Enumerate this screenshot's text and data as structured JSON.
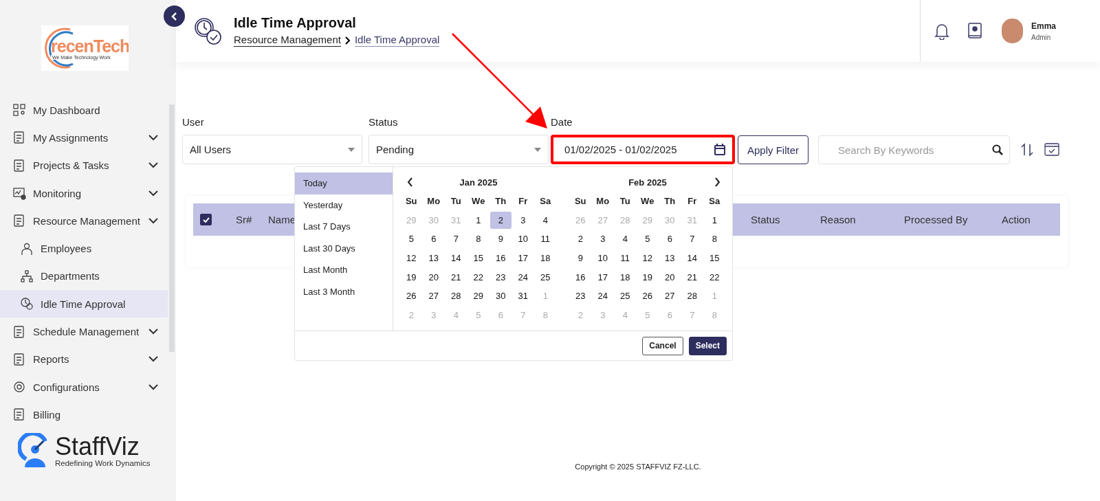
{
  "sidebar": {
    "logo": {
      "name": "recenTech",
      "tagline": "We Make Technology Work"
    },
    "items": [
      {
        "label": "My Dashboard",
        "submenu": false,
        "selected": false
      },
      {
        "label": "My Assignments",
        "submenu": true,
        "selected": false
      },
      {
        "label": "Projects & Tasks",
        "submenu": true,
        "selected": false
      },
      {
        "label": "Monitoring",
        "submenu": true,
        "selected": false
      },
      {
        "label": "Resource Management",
        "submenu": true,
        "selected": false,
        "children": [
          {
            "label": "Employees",
            "selected": false
          },
          {
            "label": "Departments",
            "selected": false
          },
          {
            "label": "Idle Time Approval",
            "selected": true
          }
        ]
      },
      {
        "label": "Schedule Management",
        "submenu": true,
        "selected": false
      },
      {
        "label": "Reports",
        "submenu": true,
        "selected": false
      },
      {
        "label": "Configurations",
        "submenu": true,
        "selected": false
      },
      {
        "label": "Billing",
        "submenu": false,
        "selected": false
      }
    ],
    "brand": {
      "name": "StaffViz",
      "tagline": "Redefining Work Dynamics"
    }
  },
  "header": {
    "title": "Idle Time Approval",
    "breadcrumb": [
      {
        "label": "Resource Management",
        "current": false
      },
      {
        "label": "Idle Time Approval",
        "current": true
      }
    ],
    "user": {
      "name": "Emma",
      "role": "Admin"
    }
  },
  "filters": {
    "user": {
      "label": "User",
      "value": "All Users"
    },
    "status": {
      "label": "Status",
      "value": "Pending"
    },
    "date": {
      "label": "Date",
      "value": "01/02/2025 - 01/02/2025",
      "highlighted": true
    },
    "apply": "Apply Filter",
    "search": {
      "placeholder": "Search By Keywords"
    }
  },
  "table": {
    "select_all_checked": true,
    "columns": [
      "Sr#",
      "Name",
      "Status",
      "Reason",
      "Processed By",
      "Action"
    ]
  },
  "date_picker": {
    "ranges": [
      {
        "label": "Today",
        "selected": true
      },
      {
        "label": "Yesterday",
        "selected": false
      },
      {
        "label": "Last 7 Days",
        "selected": false
      },
      {
        "label": "Last 30 Days",
        "selected": false
      },
      {
        "label": "Last Month",
        "selected": false
      },
      {
        "label": "Last 3 Month",
        "selected": false
      }
    ],
    "months": [
      {
        "title": "Jan 2025",
        "weekdays": [
          "Su",
          "Mo",
          "Tu",
          "We",
          "Th",
          "Fr",
          "Sa"
        ],
        "days": [
          {
            "day": "29",
            "muted": true,
            "selected": false
          },
          {
            "day": "30",
            "muted": true,
            "selected": false
          },
          {
            "day": "31",
            "muted": true,
            "selected": false
          },
          {
            "day": "1",
            "muted": false,
            "selected": false
          },
          {
            "day": "2",
            "muted": false,
            "selected": true
          },
          {
            "day": "3",
            "muted": false,
            "selected": false
          },
          {
            "day": "4",
            "muted": false,
            "selected": false
          },
          {
            "day": "5",
            "muted": false,
            "selected": false
          },
          {
            "day": "6",
            "muted": false,
            "selected": false
          },
          {
            "day": "7",
            "muted": false,
            "selected": false
          },
          {
            "day": "8",
            "muted": false,
            "selected": false
          },
          {
            "day": "9",
            "muted": false,
            "selected": false
          },
          {
            "day": "10",
            "muted": false,
            "selected": false
          },
          {
            "day": "11",
            "muted": false,
            "selected": false
          },
          {
            "day": "12",
            "muted": false,
            "selected": false
          },
          {
            "day": "13",
            "muted": false,
            "selected": false
          },
          {
            "day": "14",
            "muted": false,
            "selected": false
          },
          {
            "day": "15",
            "muted": false,
            "selected": false
          },
          {
            "day": "16",
            "muted": false,
            "selected": false
          },
          {
            "day": "17",
            "muted": false,
            "selected": false
          },
          {
            "day": "18",
            "muted": false,
            "selected": false
          },
          {
            "day": "19",
            "muted": false,
            "selected": false
          },
          {
            "day": "20",
            "muted": false,
            "selected": false
          },
          {
            "day": "21",
            "muted": false,
            "selected": false
          },
          {
            "day": "22",
            "muted": false,
            "selected": false
          },
          {
            "day": "23",
            "muted": false,
            "selected": false
          },
          {
            "day": "24",
            "muted": false,
            "selected": false
          },
          {
            "day": "25",
            "muted": false,
            "selected": false
          },
          {
            "day": "26",
            "muted": false,
            "selected": false
          },
          {
            "day": "27",
            "muted": false,
            "selected": false
          },
          {
            "day": "28",
            "muted": false,
            "selected": false
          },
          {
            "day": "29",
            "muted": false,
            "selected": false
          },
          {
            "day": "30",
            "muted": false,
            "selected": false
          },
          {
            "day": "31",
            "muted": false,
            "selected": false
          },
          {
            "day": "1",
            "muted": true,
            "selected": false
          },
          {
            "day": "2",
            "muted": true,
            "selected": false
          },
          {
            "day": "3",
            "muted": true,
            "selected": false
          },
          {
            "day": "4",
            "muted": true,
            "selected": false
          },
          {
            "day": "5",
            "muted": true,
            "selected": false
          },
          {
            "day": "6",
            "muted": true,
            "selected": false
          },
          {
            "day": "7",
            "muted": true,
            "selected": false
          },
          {
            "day": "8",
            "muted": true,
            "selected": false
          }
        ]
      },
      {
        "title": "Feb 2025",
        "weekdays": [
          "Su",
          "Mo",
          "Tu",
          "We",
          "Th",
          "Fr",
          "Sa"
        ],
        "days": [
          {
            "day": "26",
            "muted": true,
            "selected": false
          },
          {
            "day": "27",
            "muted": true,
            "selected": false
          },
          {
            "day": "28",
            "muted": true,
            "selected": false
          },
          {
            "day": "29",
            "muted": true,
            "selected": false
          },
          {
            "day": "30",
            "muted": true,
            "selected": false
          },
          {
            "day": "31",
            "muted": true,
            "selected": false
          },
          {
            "day": "1",
            "muted": false,
            "selected": false
          },
          {
            "day": "2",
            "muted": false,
            "selected": false
          },
          {
            "day": "3",
            "muted": false,
            "selected": false
          },
          {
            "day": "4",
            "muted": false,
            "selected": false
          },
          {
            "day": "5",
            "muted": false,
            "selected": false
          },
          {
            "day": "6",
            "muted": false,
            "selected": false
          },
          {
            "day": "7",
            "muted": false,
            "selected": false
          },
          {
            "day": "8",
            "muted": false,
            "selected": false
          },
          {
            "day": "9",
            "muted": false,
            "selected": false
          },
          {
            "day": "10",
            "muted": false,
            "selected": false
          },
          {
            "day": "11",
            "muted": false,
            "selected": false
          },
          {
            "day": "12",
            "muted": false,
            "selected": false
          },
          {
            "day": "13",
            "muted": false,
            "selected": false
          },
          {
            "day": "14",
            "muted": false,
            "selected": false
          },
          {
            "day": "15",
            "muted": false,
            "selected": false
          },
          {
            "day": "16",
            "muted": false,
            "selected": false
          },
          {
            "day": "17",
            "muted": false,
            "selected": false
          },
          {
            "day": "18",
            "muted": false,
            "selected": false
          },
          {
            "day": "19",
            "muted": false,
            "selected": false
          },
          {
            "day": "20",
            "muted": false,
            "selected": false
          },
          {
            "day": "21",
            "muted": false,
            "selected": false
          },
          {
            "day": "22",
            "muted": false,
            "selected": false
          },
          {
            "day": "23",
            "muted": false,
            "selected": false
          },
          {
            "day": "24",
            "muted": false,
            "selected": false
          },
          {
            "day": "25",
            "muted": false,
            "selected": false
          },
          {
            "day": "26",
            "muted": false,
            "selected": false
          },
          {
            "day": "27",
            "muted": false,
            "selected": false
          },
          {
            "day": "28",
            "muted": false,
            "selected": false
          },
          {
            "day": "1",
            "muted": true,
            "selected": false
          },
          {
            "day": "2",
            "muted": true,
            "selected": false
          },
          {
            "day": "3",
            "muted": true,
            "selected": false
          },
          {
            "day": "4",
            "muted": true,
            "selected": false
          },
          {
            "day": "5",
            "muted": true,
            "selected": false
          },
          {
            "day": "6",
            "muted": true,
            "selected": false
          },
          {
            "day": "7",
            "muted": true,
            "selected": false
          },
          {
            "day": "8",
            "muted": true,
            "selected": false
          }
        ]
      }
    ],
    "cancel": "Cancel",
    "select": "Select"
  },
  "footer": "Copyright © 2025 STAFFVIZ FZ-LLC."
}
